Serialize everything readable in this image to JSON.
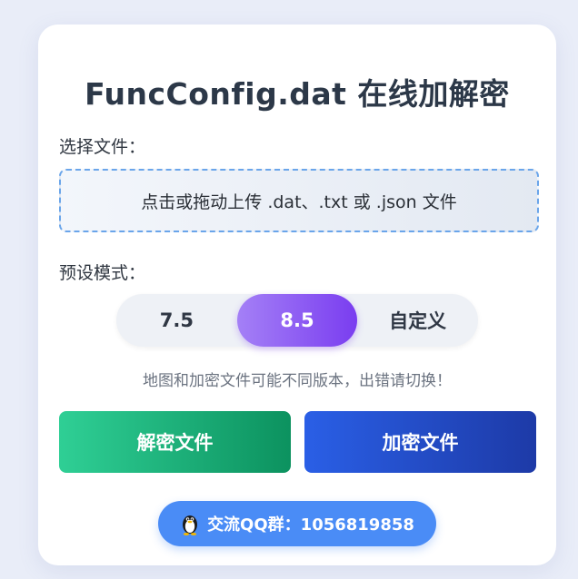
{
  "app": {
    "title": "FuncConfig.dat 在线加解密"
  },
  "file_section": {
    "label": "选择文件：",
    "dropzone_text": "点击或拖动上传 .dat、.txt 或 .json 文件"
  },
  "preset_section": {
    "label": "预设模式：",
    "options": [
      {
        "label": "7.5",
        "active": false
      },
      {
        "label": "8.5",
        "active": true
      },
      {
        "label": "自定义",
        "active": false
      }
    ],
    "hint": "地图和加密文件可能不同版本，出错请切换！"
  },
  "actions": {
    "decrypt_label": "解密文件",
    "encrypt_label": "加密文件"
  },
  "community": {
    "icon": "penguin-icon",
    "label": "交流QQ群：1056819858"
  },
  "colors": {
    "active_segment": "#7a3df0",
    "decrypt_button": "#0c925f",
    "encrypt_button": "#1d3aa7",
    "qq_button": "#4a8cf6",
    "dropzone_border": "#6aa5ea"
  }
}
